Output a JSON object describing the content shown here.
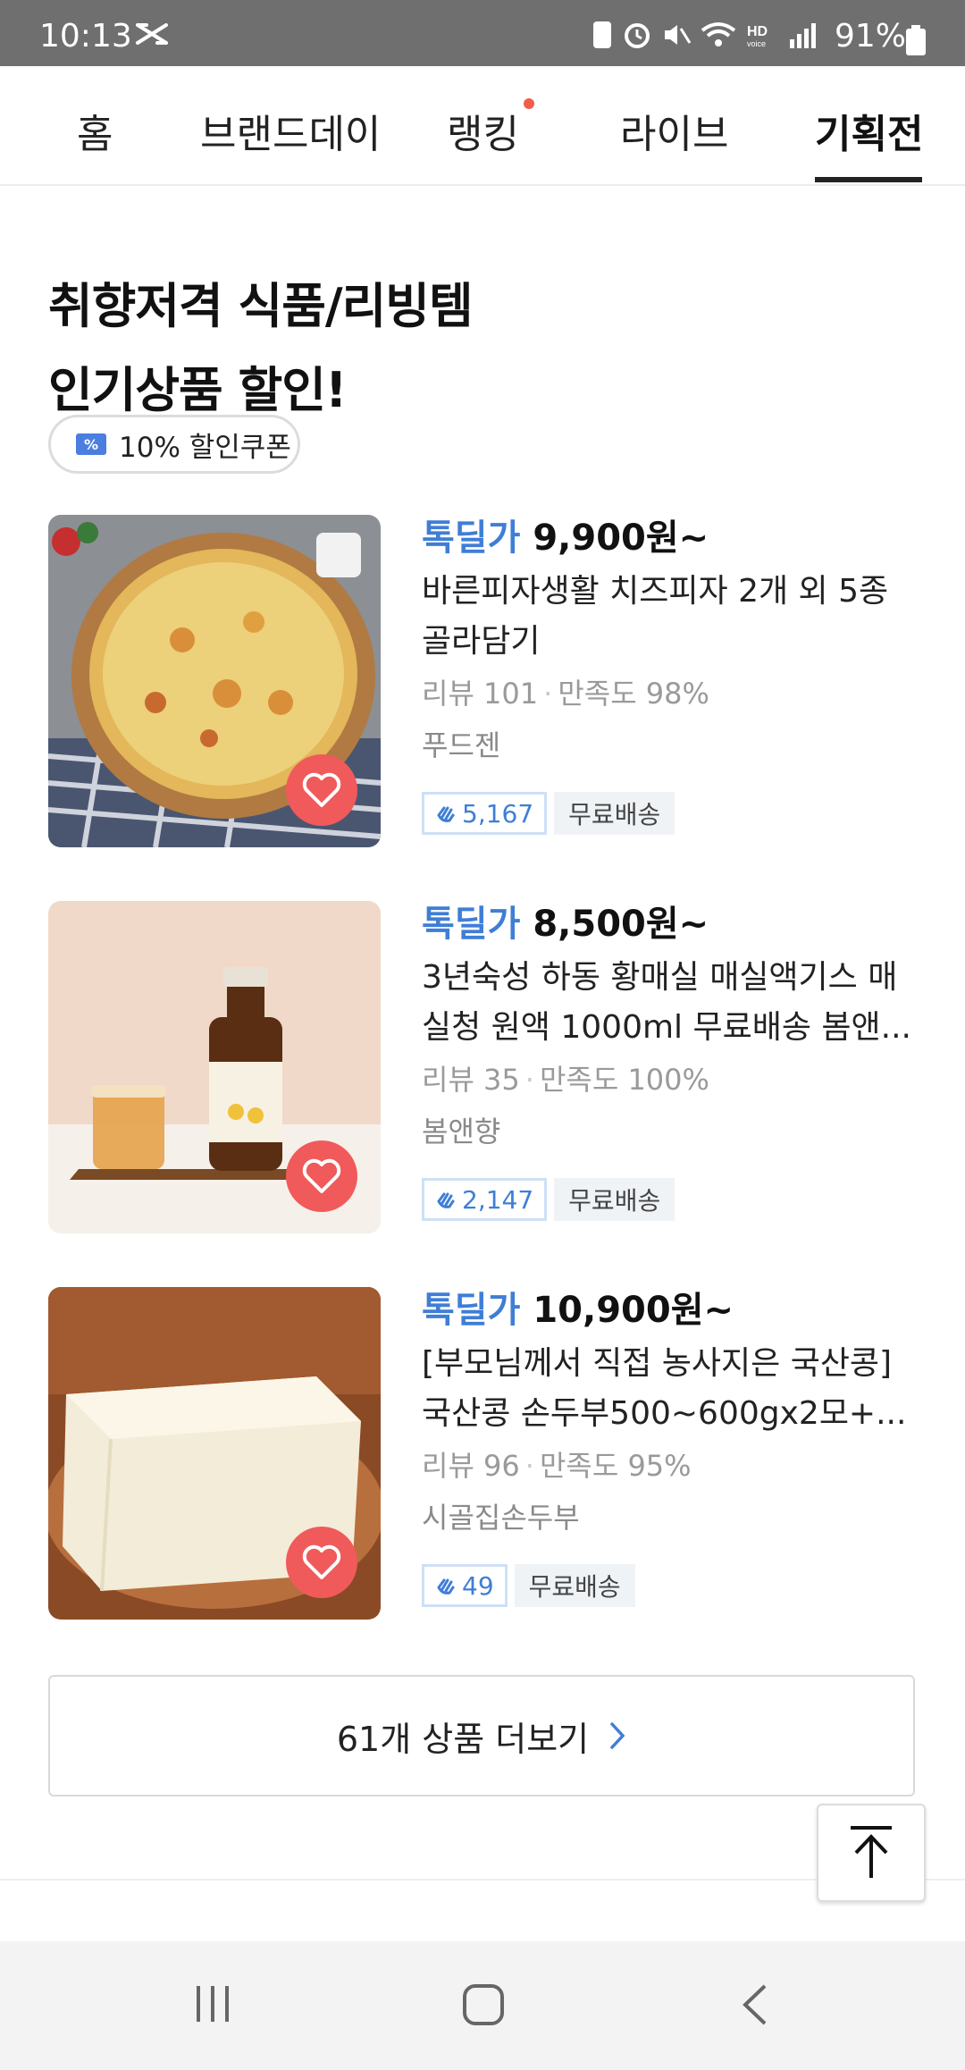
{
  "status_bar": {
    "time": "10:13",
    "battery": "91%"
  },
  "tabs": [
    {
      "label": "홈"
    },
    {
      "label": "브랜드데이"
    },
    {
      "label": "랭킹"
    },
    {
      "label": "라이브"
    },
    {
      "label": "기획전"
    }
  ],
  "active_tab": "기획전",
  "headline": {
    "line1": "취향저격 식품/리빙템",
    "line2": "인기상품 할인!"
  },
  "coupon": {
    "label": "10% 할인쿠폰"
  },
  "products": [
    {
      "price_tag": "톡딜가",
      "price": "9,900원~",
      "title_line1": "바른피자생활 치즈피자 2개 외 5종",
      "title_line2": "골라담기",
      "review": "리뷰 101",
      "satisfaction": "만족도 98%",
      "seller": "푸드젠",
      "count": "5,167",
      "shipping": "무료배송"
    },
    {
      "price_tag": "톡딜가",
      "price": "8,500원~",
      "title_line1": "3년숙성 하동 황매실 매실액기스 매",
      "title_line2": "실청 원액 1000ml 무료배송 봄앤...",
      "review": "리뷰 35",
      "satisfaction": "만족도 100%",
      "seller": "봄앤향",
      "count": "2,147",
      "shipping": "무료배송"
    },
    {
      "price_tag": "톡딜가",
      "price": "10,900원~",
      "title_line1": "[부모님께서 직접 농사지은 국산콩]",
      "title_line2": "국산콩 손두부500~600gx2모+...",
      "review": "리뷰 96",
      "satisfaction": "만족도 95%",
      "seller": "시골집손두부",
      "count": "49",
      "shipping": "무료배송"
    }
  ],
  "more": {
    "label": "61개 상품 더보기"
  },
  "colors": {
    "accent": "#3f7ed6",
    "heart": "#f05a5a",
    "status_bar": "#6f6f6f"
  }
}
